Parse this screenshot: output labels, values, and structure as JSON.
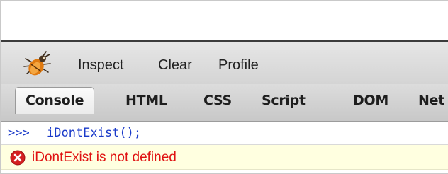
{
  "toolbar": {
    "icon": "firebug-bug-icon",
    "buttons": {
      "inspect": "Inspect",
      "clear": "Clear",
      "profile": "Profile"
    }
  },
  "tabs": {
    "console": "Console",
    "html": "HTML",
    "css": "CSS",
    "script": "Script",
    "dom": "DOM",
    "net": "Net"
  },
  "active_tab": "Console",
  "console": {
    "command": {
      "prompt": ">>>",
      "text": "iDontExist();"
    },
    "error": {
      "icon": "error-x-icon",
      "message": "iDontExist is not defined"
    }
  },
  "colors": {
    "command_text": "#1a3ac9",
    "error_text": "#e01212",
    "error_row_background": "#ffffe0",
    "error_icon": "#d42020"
  }
}
